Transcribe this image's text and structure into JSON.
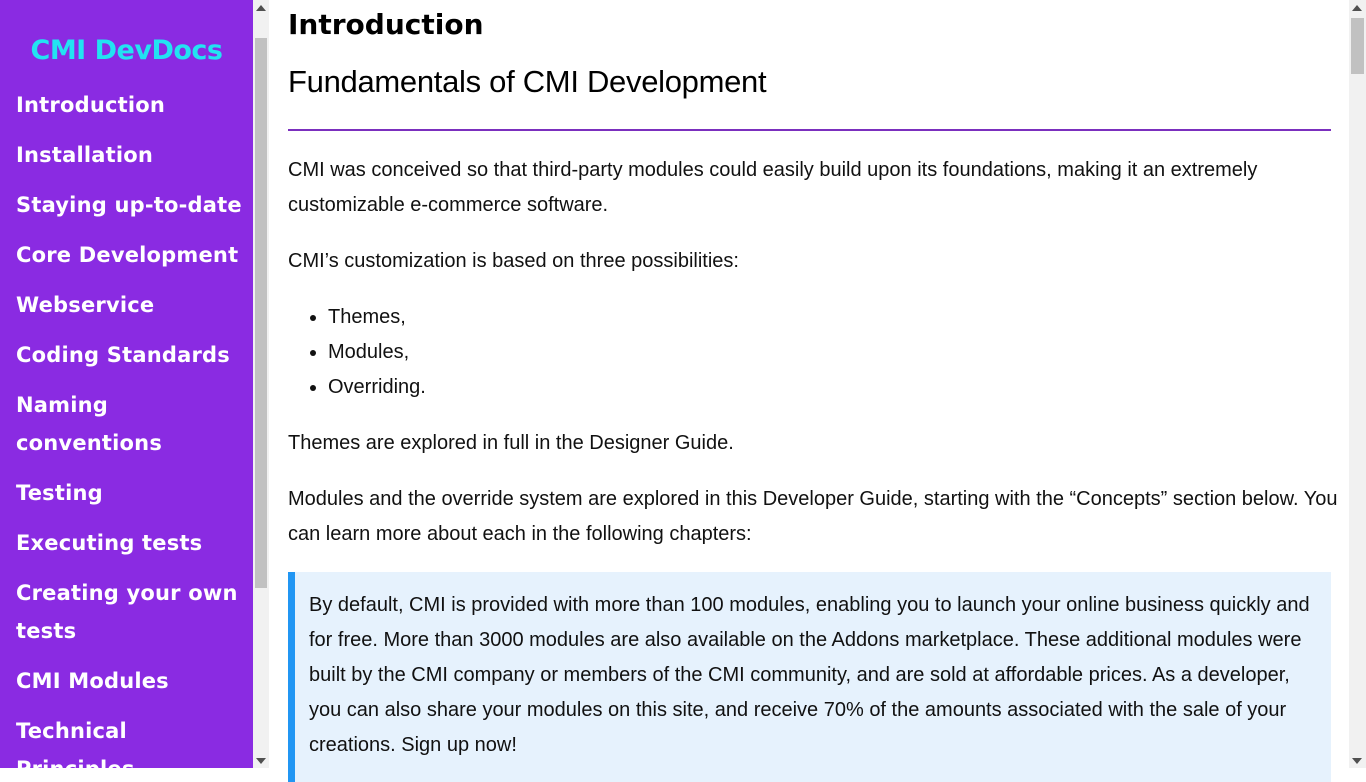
{
  "sidebar": {
    "brand": "CMI DevDocs",
    "items": [
      {
        "label": "Introduction"
      },
      {
        "label": "Installation"
      },
      {
        "label": "Staying up-to-date"
      },
      {
        "label": "Core Development"
      },
      {
        "label": "Webservice"
      },
      {
        "label": "Coding Standards"
      },
      {
        "label": "Naming conventions"
      },
      {
        "label": "Testing"
      },
      {
        "label": "Executing tests"
      },
      {
        "label": "Creating your own tests"
      },
      {
        "label": "CMI Modules"
      },
      {
        "label": "Technical Principles"
      }
    ]
  },
  "main": {
    "page_title": "Introduction",
    "heading": "Fundamentals of CMI Development",
    "paragraph1": "CMI was conceived so that third-party modules could easily build upon its foundations, making it an extremely customizable e-commerce software.",
    "paragraph2": "CMI’s customization is based on three possibilities:",
    "list": [
      "Themes,",
      "Modules,",
      "Overriding."
    ],
    "paragraph3": "Themes are explored in full in the Designer Guide.",
    "paragraph4": "Modules and the override system are explored in this Developer Guide, starting with the “Concepts” section below. You can learn more about each in the following chapters:",
    "callout": "By default, CMI is provided with more than 100 modules, enabling you to launch your online business quickly and for free. More than 3000 modules are also available on the Addons marketplace. These additional modules were built by the CMI company or members of the CMI community, and are sold at affordable prices. As a developer, you can also share your modules on this site, and receive 70% of the amounts associated with the sale of your creations. Sign up now!"
  },
  "colors": {
    "sidebar_bg": "#8a2be2",
    "brand": "#22e3f2",
    "rule": "#7b2fbe",
    "callout_bg": "#e6f2fd",
    "callout_border": "#2196f3"
  }
}
